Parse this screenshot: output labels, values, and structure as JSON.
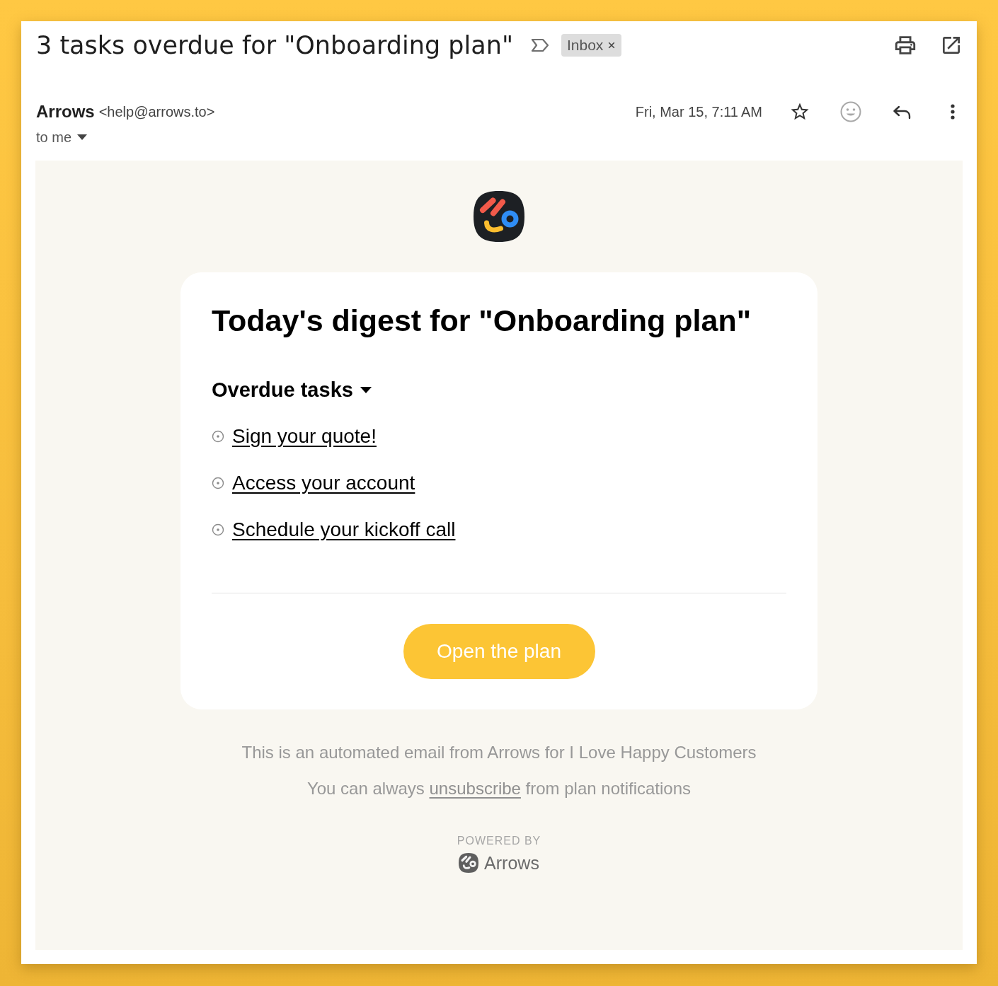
{
  "subject": {
    "title": "3 tasks overdue for \"Onboarding plan\"",
    "label": "Inbox"
  },
  "sender": {
    "name": "Arrows",
    "email": "<help@arrows.to>",
    "recipient": "to me",
    "date": "Fri, Mar 15, 7:11 AM",
    "starred": false
  },
  "digest": {
    "title": "Today's digest for \"Onboarding plan\"",
    "section": {
      "title": "Overdue tasks",
      "expanded": true,
      "tasks": [
        "Sign your quote!",
        "Access your account",
        "Schedule your kickoff call"
      ]
    },
    "button": "Open the plan"
  },
  "footer": {
    "notice": "This is an automated email from Arrows for I Love Happy Customers",
    "unsubscribe": {
      "before": "You can always",
      "link": "unsubscribe",
      "after": "from plan notifications"
    },
    "powered_by": "POWERED BY",
    "brand": "Arrows"
  }
}
